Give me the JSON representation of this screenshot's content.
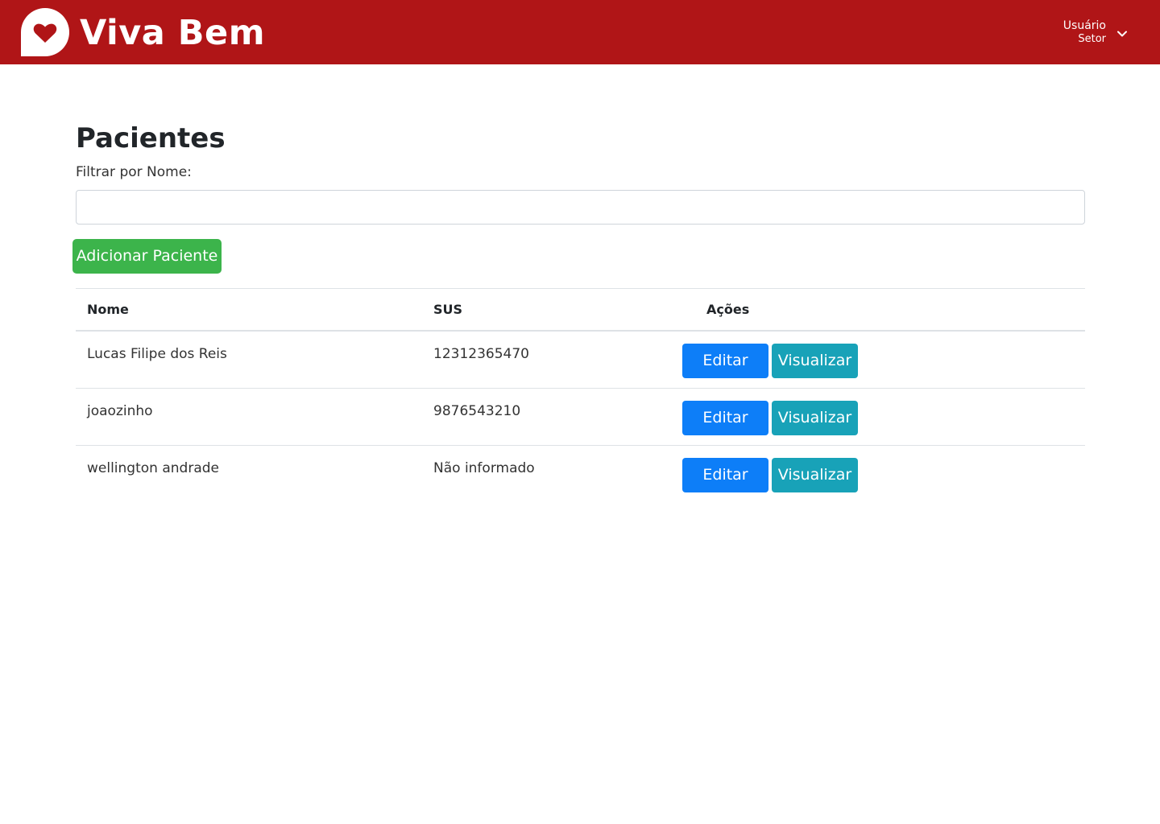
{
  "header": {
    "brand": "Viva Bem",
    "logo_icon": "heart-chat-icon",
    "user_name": "Usuário",
    "user_role": "Setor",
    "menu_icon": "chevron-down-icon",
    "colors": {
      "bar": "#b01517",
      "text": "#ffffff"
    }
  },
  "main": {
    "title": "Pacientes",
    "filter_label": "Filtrar por Nome:",
    "filter_value": "",
    "add_button": "Adicionar Paciente"
  },
  "table": {
    "headers": [
      "Nome",
      "SUS",
      "Ações"
    ],
    "rows": [
      {
        "nome": "Lucas Filipe dos Reis",
        "sus": "12312365470",
        "edit": "Editar",
        "view": "Visualizar"
      },
      {
        "nome": "joaozinho",
        "sus": "9876543210",
        "edit": "Editar",
        "view": "Visualizar"
      },
      {
        "nome": "wellington andrade",
        "sus": "Não informado",
        "edit": "Editar",
        "view": "Visualizar"
      }
    ]
  },
  "colors": {
    "add_button": "#3cb44b",
    "edit_button": "#0d7ef8",
    "view_button": "#18a2b8"
  }
}
